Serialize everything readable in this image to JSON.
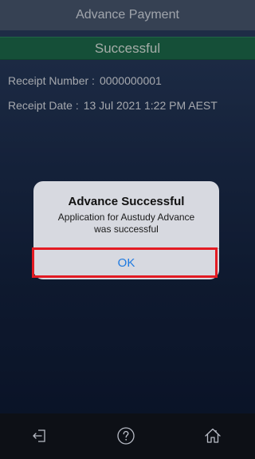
{
  "header": {
    "title": "Advance Payment"
  },
  "status": {
    "label": "Successful"
  },
  "receipt": {
    "number_label": "Receipt Number :",
    "number_value": "0000000001",
    "date_label": "Receipt Date :",
    "date_value": "13 Jul 2021 1:22 PM AEST"
  },
  "dialog": {
    "title": "Advance Successful",
    "message_line1": "Application for Austudy Advance",
    "message_line2": "was successful",
    "ok_label": "OK"
  },
  "toolbar": {
    "icons": [
      "logout-icon",
      "help-icon",
      "home-icon"
    ]
  },
  "colors": {
    "nav_bar": "#4b5a73",
    "status_banner": "#1e6e4e",
    "ok_text": "#1f7ae0",
    "highlight": "#e31b23"
  }
}
